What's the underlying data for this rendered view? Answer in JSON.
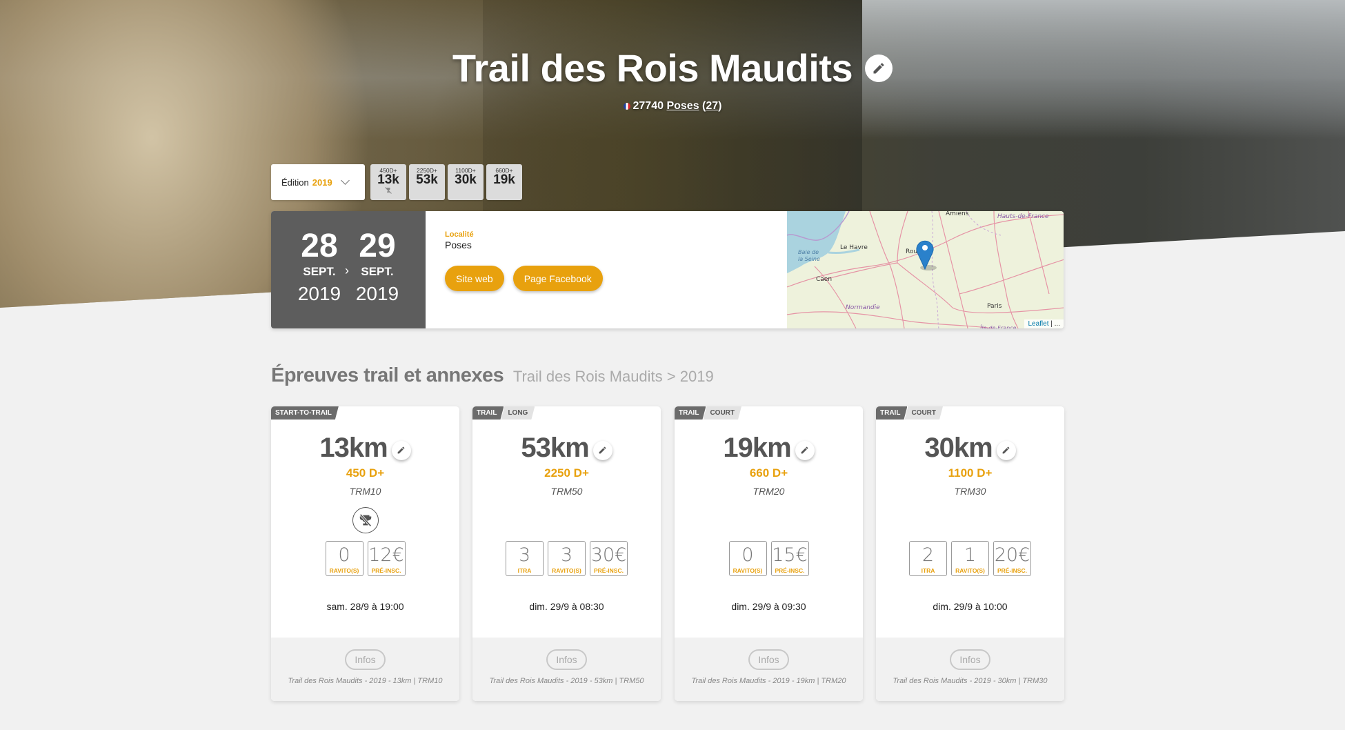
{
  "event": {
    "title": "Trail des Rois Maudits",
    "postal_code": "27740",
    "city": "Poses",
    "count": "27",
    "country": "France"
  },
  "edition": {
    "label": "Édition",
    "year": "2019"
  },
  "distance_chips": [
    {
      "dplus": "450D+",
      "km": "13k",
      "icon": "no-trophy-icon"
    },
    {
      "dplus": "2250D+",
      "km": "53k"
    },
    {
      "dplus": "1100D+",
      "km": "30k"
    },
    {
      "dplus": "660D+",
      "km": "19k"
    }
  ],
  "dates": {
    "start": {
      "day": "28",
      "month": "SEPT.",
      "year": "2019"
    },
    "end": {
      "day": "29",
      "month": "SEPT.",
      "year": "2019"
    }
  },
  "location": {
    "label": "Localité",
    "value": "Poses"
  },
  "buttons": {
    "website": "Site web",
    "facebook": "Page Facebook"
  },
  "map": {
    "labels": [
      "Amiens",
      "Hauts-de-France",
      "Le Havre",
      "Baie de",
      "la Seine",
      "Rouen",
      "Caen",
      "Normandie",
      "Paris",
      "Île-de-France"
    ],
    "attribution": "Leaflet",
    "attribution_more": "| ..."
  },
  "section": {
    "title": "Épreuves trail et annexes",
    "breadcrumb": "Trail des Rois Maudits > 2019"
  },
  "races": [
    {
      "tags": [
        "START-TO-TRAIL"
      ],
      "distance": "13km",
      "dplus": "450 D+",
      "code": "TRM10",
      "no_trophy": true,
      "stats": [
        {
          "value": "0",
          "label": "RAVITO(S)"
        },
        {
          "value": "12€",
          "label": "PRÉ-INSC."
        }
      ],
      "start": "sam. 28/9 à 19:00",
      "infos": "Infos",
      "desc": "Trail des Rois Maudits - 2019 - 13km | TRM10"
    },
    {
      "tags": [
        "TRAIL",
        "LONG"
      ],
      "distance": "53km",
      "dplus": "2250 D+",
      "code": "TRM50",
      "stats": [
        {
          "value": "3",
          "label": "ITRA"
        },
        {
          "value": "3",
          "label": "RAVITO(S)"
        },
        {
          "value": "30€",
          "label": "PRÉ-INSC."
        }
      ],
      "start": "dim. 29/9 à 08:30",
      "infos": "Infos",
      "desc": "Trail des Rois Maudits - 2019 - 53km | TRM50"
    },
    {
      "tags": [
        "TRAIL",
        "COURT"
      ],
      "distance": "19km",
      "dplus": "660 D+",
      "code": "TRM20",
      "stats": [
        {
          "value": "0",
          "label": "RAVITO(S)"
        },
        {
          "value": "15€",
          "label": "PRÉ-INSC."
        }
      ],
      "start": "dim. 29/9 à 09:30",
      "infos": "Infos",
      "desc": "Trail des Rois Maudits - 2019 - 19km | TRM20"
    },
    {
      "tags": [
        "TRAIL",
        "COURT"
      ],
      "distance": "30km",
      "dplus": "1100 D+",
      "code": "TRM30",
      "stats": [
        {
          "value": "2",
          "label": "ITRA"
        },
        {
          "value": "1",
          "label": "RAVITO(S)"
        },
        {
          "value": "20€",
          "label": "PRÉ-INSC."
        }
      ],
      "start": "dim. 29/9 à 10:00",
      "infos": "Infos",
      "desc": "Trail des Rois Maudits - 2019 - 30km | TRM30"
    }
  ],
  "colors": {
    "accent": "#e8a10e",
    "date_panel": "#5d5d5d",
    "page_bg": "#f1f1f1"
  }
}
